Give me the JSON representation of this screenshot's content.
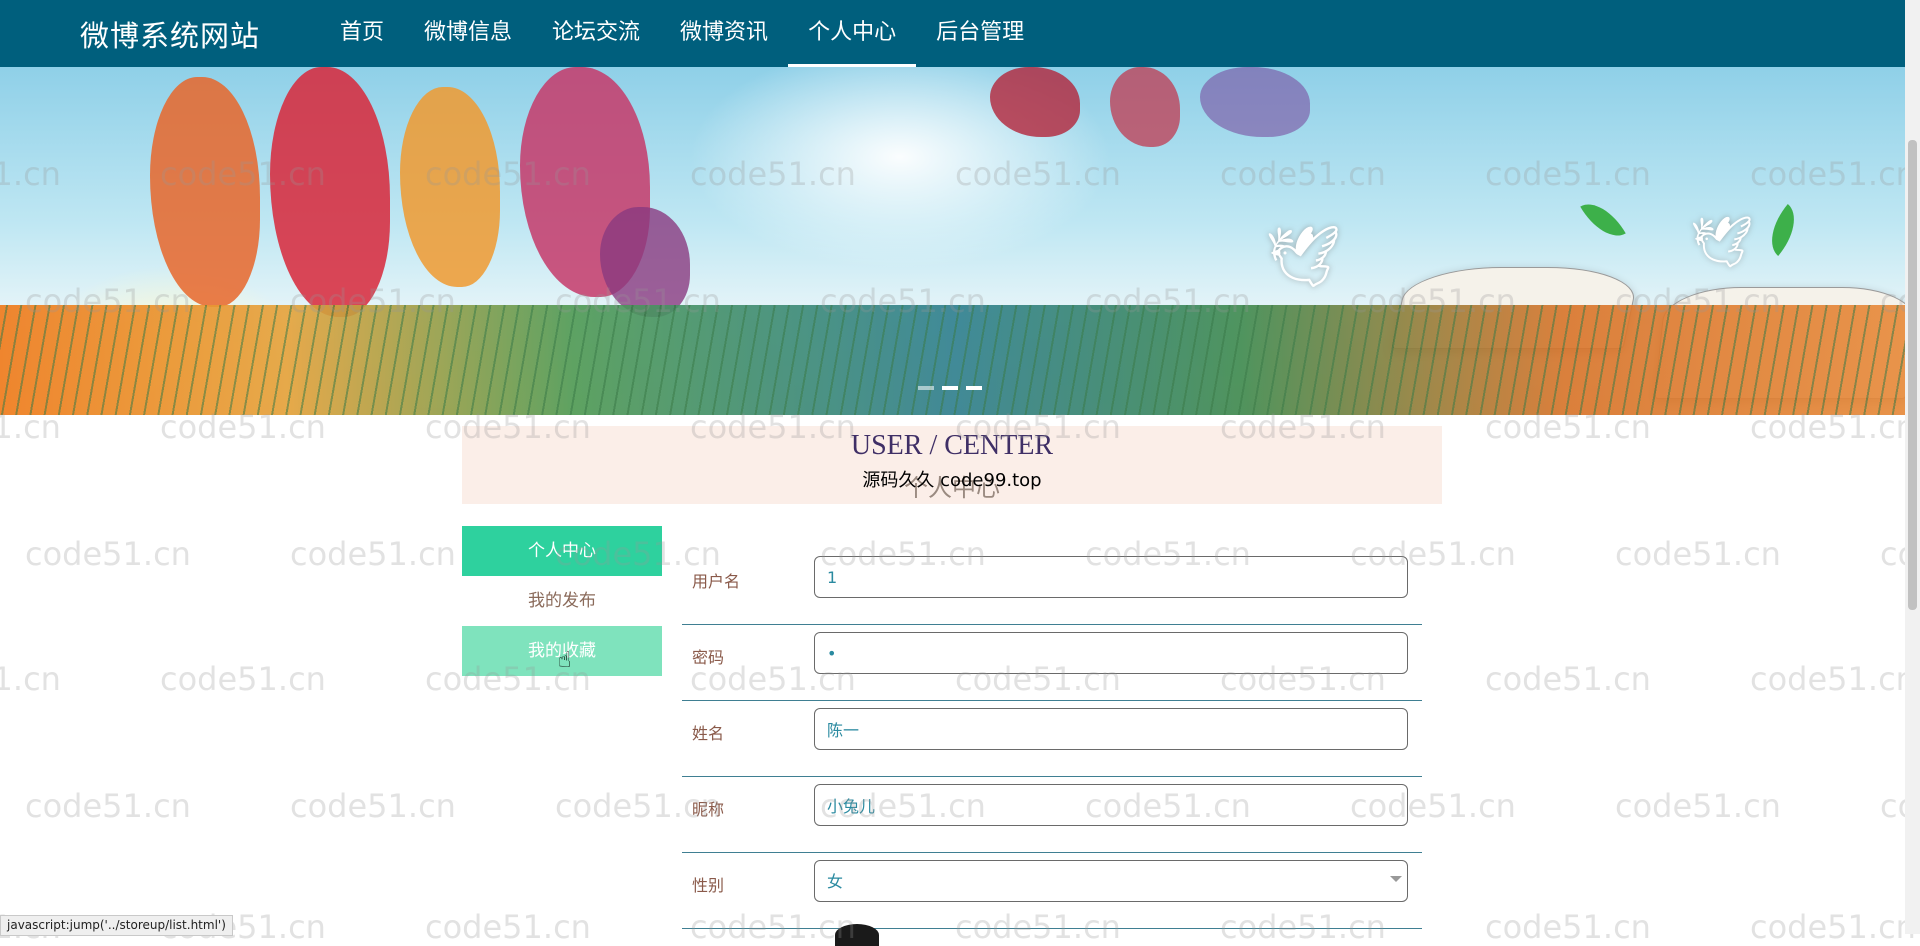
{
  "header": {
    "site_title": "微博系统网站",
    "nav": [
      {
        "label": "首页",
        "active": false
      },
      {
        "label": "微博信息",
        "active": false
      },
      {
        "label": "论坛交流",
        "active": false
      },
      {
        "label": "微博资讯",
        "active": false
      },
      {
        "label": "个人中心",
        "active": true
      },
      {
        "label": "后台管理",
        "active": false
      }
    ]
  },
  "banner": {
    "slides_total": 3,
    "active_slide": 2
  },
  "page_heading": {
    "en": "USER / CENTER",
    "cn": "个人中心",
    "overlay_note": "源码久久 code99.top"
  },
  "side_menu": [
    {
      "label": "个人中心",
      "state": "selected"
    },
    {
      "label": "我的发布",
      "state": "normal"
    },
    {
      "label": "我的收藏",
      "state": "hover"
    }
  ],
  "form": {
    "fields": [
      {
        "label": "用户名",
        "value": "1",
        "type": "text"
      },
      {
        "label": "密码",
        "value": "•",
        "type": "password"
      },
      {
        "label": "姓名",
        "value": "陈一",
        "type": "text"
      },
      {
        "label": "昵称",
        "value": "小兔儿",
        "type": "text"
      },
      {
        "label": "性别",
        "value": "女",
        "type": "select"
      }
    ]
  },
  "status_bar": {
    "text": "javascript:jump('../storeup/list.html')"
  },
  "watermark": {
    "text": "code51.cn"
  },
  "colors": {
    "header_bg": "#005f7d",
    "menu_selected": "#2ed19e",
    "menu_hover": "#7fe3bd",
    "heading_bg": "#fbeee8",
    "row_divider": "#3f7f92"
  }
}
